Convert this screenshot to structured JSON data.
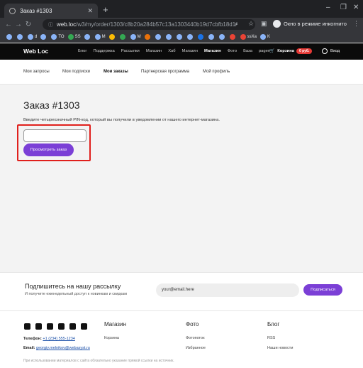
{
  "browser": {
    "tab_title": "Заказ #1303",
    "new_tab": "+",
    "url_domain": "web.loc",
    "url_path": "/w3/my/order/1303/c8b20a284b57c13a1303440b19d7cbfb18d1/",
    "incognito_label": "Окно в режиме инкогнито",
    "bookmarks": [
      "d",
      "TO",
      "SS",
      "M",
      "M",
      "ssXa",
      "K"
    ]
  },
  "site": {
    "logo": "Web Loc",
    "nav": [
      "Блог",
      "Поддержка",
      "Рассылки",
      "Магазин",
      "Хаб",
      "Магазин",
      "Магазин",
      "Фото",
      "База",
      "pagen"
    ],
    "cart_label": "Корзина",
    "cart_badge": "0 руб.",
    "login_label": "Вход"
  },
  "subnav": {
    "items": [
      "Мои запросы",
      "Мои подписки",
      "Мои заказы",
      "Партнерская программа",
      "Мой профиль"
    ]
  },
  "order": {
    "title": "Заказ #1303",
    "hint": "Введите четырехзначный PIN-код, который вы получили в уведомлении от нашего интернет-магазина.",
    "pin_value": "",
    "view_button": "Просмотреть заказ"
  },
  "subscribe": {
    "title": "Подпишитесь на нашу рассылку",
    "text": "И получите еженедельный доступ к новинкам и скидкам",
    "email_value": "your@email.here",
    "button": "Подписаться"
  },
  "footer": {
    "phone_label": "Телефон:",
    "phone": "+1 (234) 555-1234",
    "email_label": "Email:",
    "email": "georgiy.melnikov@webasyst.ru",
    "columns": [
      {
        "title": "Магазин",
        "items": [
          "Корзина"
        ]
      },
      {
        "title": "Фото",
        "items": [
          "Фотопоток",
          "Избранное"
        ]
      },
      {
        "title": "Блог",
        "items": [
          "RSS",
          "Наши новости"
        ]
      }
    ],
    "copyright": "При использовании материалов с сайта обязательно указание прямой ссылки на источник."
  },
  "colors": {
    "accent": "#7b3fd6",
    "highlight": "#e0201c",
    "header_bg": "#0b0b0b"
  }
}
